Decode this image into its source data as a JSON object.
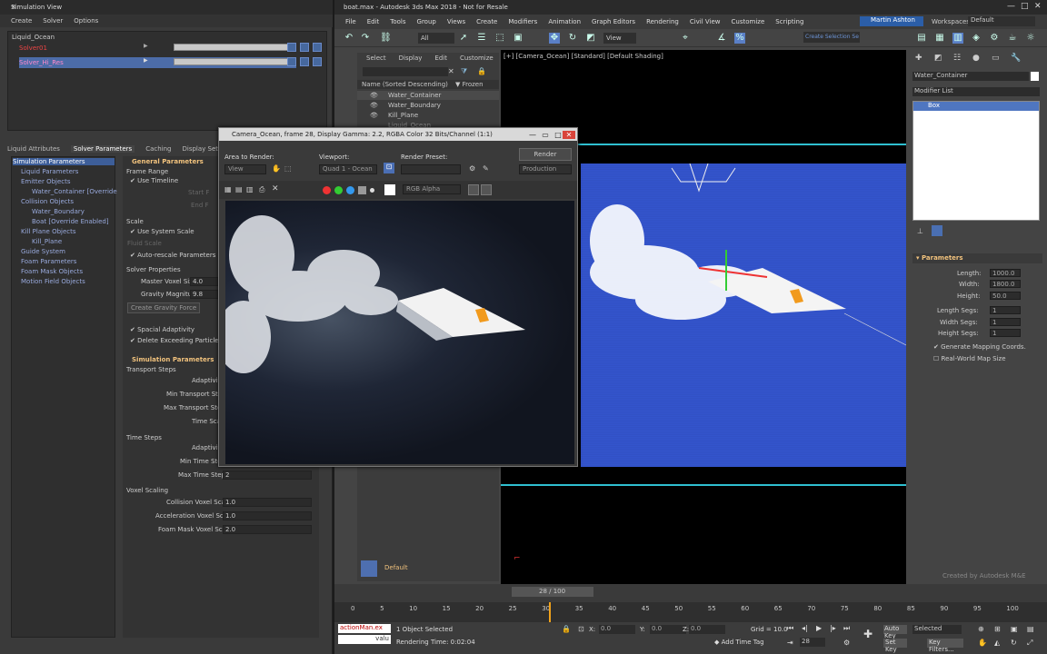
{
  "simulation_view": {
    "title": "Simulation View",
    "menu": [
      "Create",
      "Solver",
      "Options"
    ],
    "tree": {
      "root": "Liquid_Ocean",
      "items": [
        "Solver01",
        "Solver_Hi_Res"
      ]
    },
    "tabs": [
      "Liquid Attributes",
      "Solver Parameters",
      "Caching",
      "Display Settings",
      "Re"
    ],
    "settings_tree": [
      "Simulation Parameters",
      "Liquid Parameters",
      "Emitter Objects",
      "Water_Container [Override",
      "Collision Objects",
      "Water_Boundary",
      "Boat [Override Enabled]",
      "Kill Plane Objects",
      "Kill_Plane",
      "Guide System",
      "Foam Parameters",
      "Foam Mask Objects",
      "Motion Field Objects"
    ],
    "params": {
      "general_header": "General Parameters",
      "frame_range": "Frame Range",
      "use_timeline": "Use Timeline",
      "start_frame": "Start F",
      "end_frame": "End F",
      "scale": "Scale",
      "use_system_scale": "Use System Scale",
      "fluid_scale": "Fluid Scale",
      "auto_rescale": "Auto-rescale Parameters",
      "solver_properties": "Solver Properties",
      "master_voxel_label": "Master Voxel Size",
      "master_voxel_value": "4.0",
      "gravity_label": "Gravity Magnitude",
      "gravity_value": "9.8",
      "create_gravity": "Create Gravity Force",
      "spacial_adaptivity": "Spacial Adaptivity",
      "delete_exceeding": "Delete Exceeding Particles",
      "sim_header": "Simulation Parameters",
      "transport_steps": "Transport Steps",
      "adaptivity_1": "Adaptivit",
      "min_transport": "Min Transport Step",
      "max_transport": "Max Transport Step",
      "time_scale": "Time Sca",
      "time_steps": "Time Steps",
      "adaptivity_2": "Adaptivit",
      "min_time": "Min Time Ste",
      "max_time_label": "Max Time Steps",
      "max_time_value": "2",
      "voxel_scaling": "Voxel Scaling",
      "collision_voxel_label": "Collision Voxel Scale",
      "collision_voxel_value": "1.0",
      "accel_voxel_label": "Acceleration Voxel Scale",
      "accel_voxel_value": "1.0",
      "foam_mask_label": "Foam Mask Voxel Scale",
      "foam_mask_value": "2.0"
    }
  },
  "max": {
    "title": "boat.max - Autodesk 3ds Max 2018 - Not for Resale",
    "menu": [
      "File",
      "Edit",
      "Tools",
      "Group",
      "Views",
      "Create",
      "Modifiers",
      "Animation",
      "Graph Editors",
      "Rendering",
      "Civil View",
      "Customize",
      "Scripting"
    ],
    "user": "Martin Ashton",
    "workspaces_label": "Workspaces:",
    "workspaces_value": "Default",
    "toolbar_filter": "All",
    "toolbar_view": "View",
    "create_selection_set": "Create Selection Se",
    "explorer": {
      "tabs": [
        "Select",
        "Display",
        "Edit",
        "Customize"
      ],
      "header": "Name (Sorted Descending)",
      "frozen": "Frozen",
      "items": [
        "Water_Container",
        "Water_Boundary",
        "Kill_Plane",
        "Liquid_Ocean"
      ]
    },
    "viewport_label": "[+] [Camera_Ocean] [Standard] [Default Shading]",
    "command_panel": {
      "object_name": "Water_Container",
      "modifier_list": "Modifier List",
      "stack_item": "Box",
      "params_header": "Parameters",
      "fields": [
        {
          "label": "Length:",
          "value": "1000.0"
        },
        {
          "label": "Width:",
          "value": "1800.0"
        },
        {
          "label": "Height:",
          "value": "50.0"
        },
        {
          "label": "Length Segs:",
          "value": "1"
        },
        {
          "label": "Width Segs:",
          "value": "1"
        },
        {
          "label": "Height Segs:",
          "value": "1"
        }
      ],
      "gen_mapping": "Generate Mapping Coords.",
      "real_world": "Real-World Map Size"
    },
    "watermark": "Created by Autodesk M&E",
    "layer_default": "Default",
    "timeline_value": "28 / 100",
    "timeline_ticks": [
      "0",
      "5",
      "10",
      "15",
      "20",
      "25",
      "30",
      "35",
      "40",
      "45",
      "50",
      "55",
      "60",
      "65",
      "70",
      "75",
      "80",
      "85",
      "90",
      "95",
      "100"
    ],
    "status": {
      "selection": "1 Object Selected",
      "render_time": "Rendering Time: 0:02:04",
      "x_label": "X:",
      "x_value": "0.0",
      "y_label": "Y:",
      "y_value": "0.0",
      "z_label": "Z:",
      "z_value": "0.0",
      "grid": "Grid = 10.0",
      "add_time_tag": "Add Time Tag",
      "auto_key": "Auto Key",
      "set_key": "Set Key",
      "selected": "Selected",
      "key_filters": "Key Filters...",
      "frame": "28",
      "maxscript": "actionMan.ex",
      "maxscript2": "valu"
    }
  },
  "render_window": {
    "title": "Camera_Ocean, frame 28, Display Gamma: 2.2, RGBA Color 32 Bits/Channel (1:1)",
    "area_label": "Area to Render:",
    "area_value": "View",
    "viewport_label": "Viewport:",
    "viewport_value": "Quad 1 - Ocean",
    "preset_label": "Render Preset:",
    "preset_value": "",
    "render_btn": "Render",
    "mode_value": "Production",
    "channel_value": "RGB Alpha"
  }
}
